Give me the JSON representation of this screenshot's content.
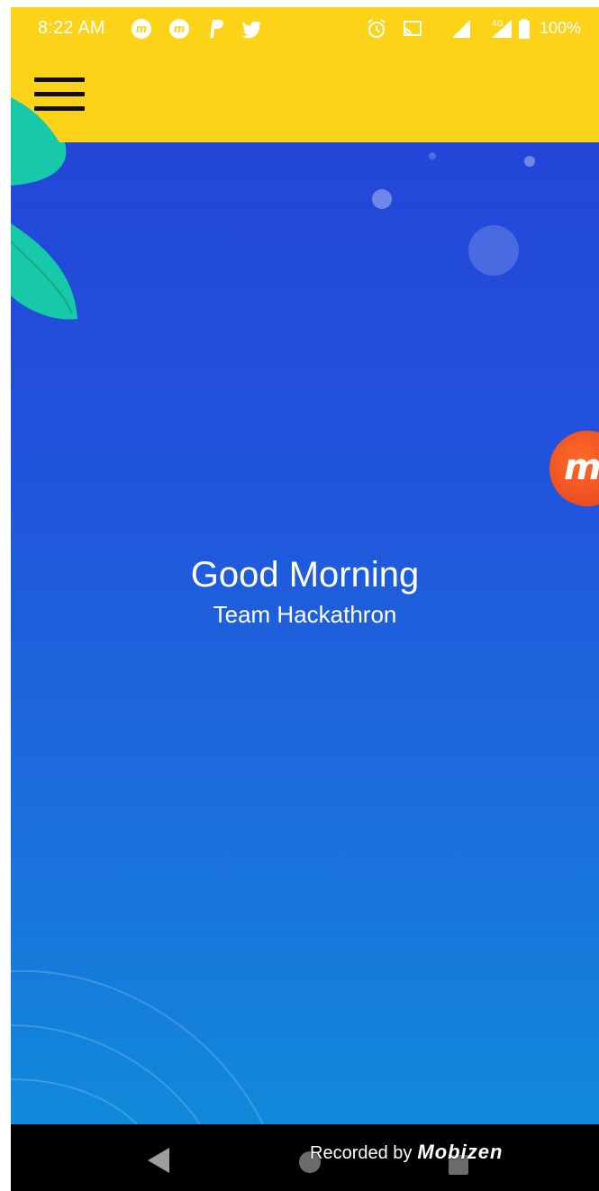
{
  "status_bar": {
    "time": "8:22 AM",
    "battery_text": "100%",
    "network_label": "4G",
    "icons": [
      "mobizen-icon",
      "mobizen-icon",
      "paypal-icon",
      "twitter-icon",
      "alarm-icon",
      "cast-icon",
      "signal-icon",
      "signal-4g-icon",
      "battery-icon"
    ]
  },
  "app_bar": {
    "menu_icon": "hamburger-menu-icon"
  },
  "greeting": {
    "title": "Good Morning",
    "subtitle": "Team Hackathron"
  },
  "overlay": {
    "mobizen_letter": "m",
    "recorded_by": "Recorded by",
    "brand": "Mobizen"
  },
  "colors": {
    "app_bar": "#fdd319",
    "background_top": "#2346d9",
    "background_bottom": "#1089da",
    "leaf": "#17c9a8",
    "mobizen": "#e3411a"
  }
}
